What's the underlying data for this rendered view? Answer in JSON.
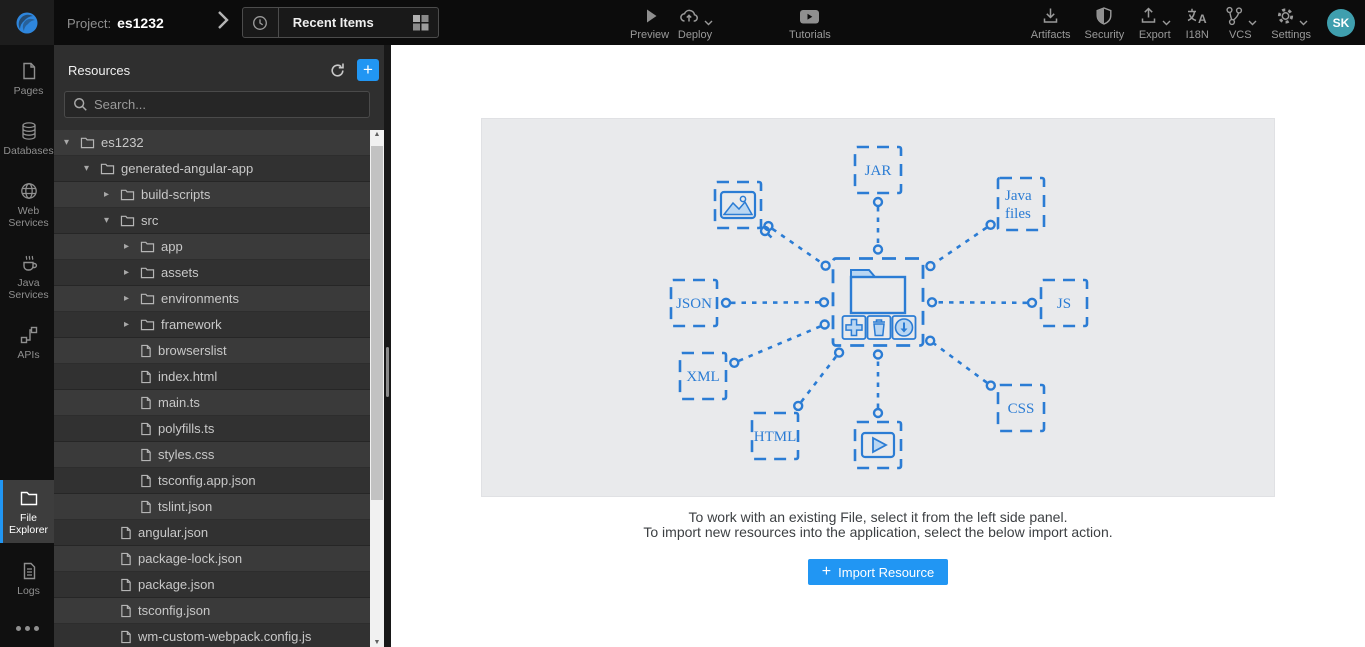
{
  "topbar": {
    "project_label": "Project:",
    "project_name": "es1232",
    "recent_items_label": "Recent Items",
    "center_actions": [
      {
        "id": "preview",
        "label": "Preview",
        "caret": false
      },
      {
        "id": "deploy",
        "label": "Deploy",
        "caret": true
      },
      {
        "id": "tutorials",
        "label": "Tutorials",
        "caret": false
      }
    ],
    "right_actions": [
      {
        "id": "artifacts",
        "label": "Artifacts",
        "caret": false
      },
      {
        "id": "security",
        "label": "Security",
        "caret": false
      },
      {
        "id": "export",
        "label": "Export",
        "caret": true
      },
      {
        "id": "i18n",
        "label": "I18N",
        "caret": false
      },
      {
        "id": "vcs",
        "label": "VCS",
        "caret": true
      },
      {
        "id": "settings",
        "label": "Settings",
        "caret": true
      }
    ],
    "avatar_initials": "SK"
  },
  "sidebar": {
    "top_items": [
      {
        "id": "pages",
        "label": "Pages"
      },
      {
        "id": "databases",
        "label": "Databases"
      },
      {
        "id": "web-services",
        "label": "Web Services"
      },
      {
        "id": "java-services",
        "label": "Java Services"
      },
      {
        "id": "apis",
        "label": "APIs"
      }
    ],
    "bottom_items": [
      {
        "id": "file-explorer",
        "label": "File Explorer",
        "active": true
      },
      {
        "id": "logs",
        "label": "Logs",
        "active": false
      }
    ]
  },
  "resources": {
    "title": "Resources",
    "search_placeholder": "Search...",
    "tree": [
      {
        "label": "es1232",
        "type": "folder",
        "state": "expanded",
        "level": 0
      },
      {
        "label": "generated-angular-app",
        "type": "folder",
        "state": "expanded",
        "level": 1
      },
      {
        "label": "build-scripts",
        "type": "folder",
        "state": "collapsed",
        "level": 2
      },
      {
        "label": "src",
        "type": "folder",
        "state": "expanded",
        "level": 2
      },
      {
        "label": "app",
        "type": "folder",
        "state": "collapsed",
        "level": 3
      },
      {
        "label": "assets",
        "type": "folder",
        "state": "collapsed",
        "level": 3
      },
      {
        "label": "environments",
        "type": "folder",
        "state": "collapsed",
        "level": 3
      },
      {
        "label": "framework",
        "type": "folder",
        "state": "collapsed",
        "level": 3
      },
      {
        "label": "browserslist",
        "type": "file",
        "level": 3
      },
      {
        "label": "index.html",
        "type": "file",
        "level": 3
      },
      {
        "label": "main.ts",
        "type": "file",
        "level": 3
      },
      {
        "label": "polyfills.ts",
        "type": "file",
        "level": 3
      },
      {
        "label": "styles.css",
        "type": "file",
        "level": 3
      },
      {
        "label": "tsconfig.app.json",
        "type": "file",
        "level": 3
      },
      {
        "label": "tslint.json",
        "type": "file",
        "level": 3
      },
      {
        "label": "angular.json",
        "type": "file",
        "level": 2
      },
      {
        "label": "package-lock.json",
        "type": "file",
        "level": 2
      },
      {
        "label": "package.json",
        "type": "file",
        "level": 2
      },
      {
        "label": "tsconfig.json",
        "type": "file",
        "level": 2
      },
      {
        "label": "wm-custom-webpack.config.js",
        "type": "file",
        "level": 2
      }
    ]
  },
  "main": {
    "instruction_line1": "To work with an existing File, select it from the left side panel.",
    "instruction_line2": "To import new resources into the application, select the below import action.",
    "import_button_label": "Import Resource",
    "diagram": {
      "center_node": {
        "id": "central-folder",
        "actions": [
          "add",
          "delete",
          "download"
        ]
      },
      "nodes": [
        {
          "id": "image-file",
          "kind": "image-icon",
          "label": ""
        },
        {
          "id": "jar",
          "kind": "text",
          "label": "JAR"
        },
        {
          "id": "java-files",
          "kind": "text",
          "label": "Java files"
        },
        {
          "id": "json",
          "kind": "text",
          "label": "JSON"
        },
        {
          "id": "js",
          "kind": "text",
          "label": "JS"
        },
        {
          "id": "xml",
          "kind": "text",
          "label": "XML"
        },
        {
          "id": "html",
          "kind": "text",
          "label": "HTML"
        },
        {
          "id": "video-file",
          "kind": "video-icon",
          "label": ""
        },
        {
          "id": "css",
          "kind": "text",
          "label": "CSS"
        }
      ]
    }
  },
  "colors": {
    "accent_blue": "#2196f3",
    "diagram_blue": "#2b7cd4",
    "diagram_fill_light": "#b9d6f2",
    "diagram_panel_bg": "#e9eaec",
    "avatar_bg": "#3f9fae"
  }
}
